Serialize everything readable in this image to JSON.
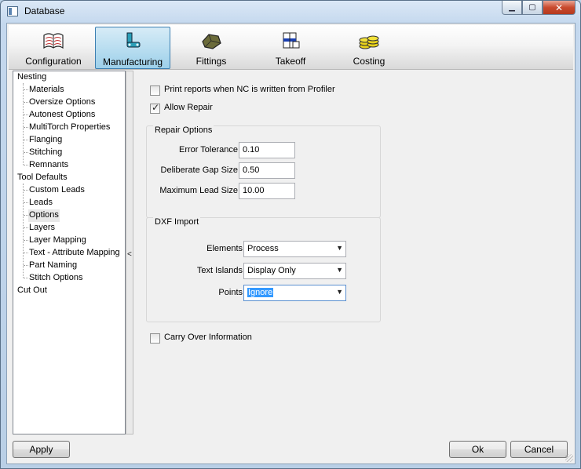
{
  "window": {
    "title": "Database"
  },
  "toolbar": {
    "tabs": [
      {
        "label": "Configuration",
        "icon": "book-icon"
      },
      {
        "label": "Manufacturing",
        "icon": "machine-icon",
        "selected": true
      },
      {
        "label": "Fittings",
        "icon": "fitting-icon"
      },
      {
        "label": "Takeoff",
        "icon": "takeoff-icon"
      },
      {
        "label": "Costing",
        "icon": "coins-icon"
      }
    ]
  },
  "tree": {
    "items": [
      {
        "label": "Nesting",
        "level": 0
      },
      {
        "label": "Materials",
        "level": 1
      },
      {
        "label": "Oversize Options",
        "level": 1
      },
      {
        "label": "Autonest Options",
        "level": 1
      },
      {
        "label": "MultiTorch Properties",
        "level": 1
      },
      {
        "label": "Flanging",
        "level": 1
      },
      {
        "label": "Stitching",
        "level": 1
      },
      {
        "label": "Remnants",
        "level": 1
      },
      {
        "label": "Tool Defaults",
        "level": 0
      },
      {
        "label": "Custom Leads",
        "level": 1
      },
      {
        "label": "Leads",
        "level": 1
      },
      {
        "label": "Options",
        "level": 1,
        "selected": true
      },
      {
        "label": "Layers",
        "level": 1
      },
      {
        "label": "Layer Mapping",
        "level": 1
      },
      {
        "label": "Text - Attribute Mapping",
        "level": 1
      },
      {
        "label": "Part Naming",
        "level": 1
      },
      {
        "label": "Stitch Options",
        "level": 1
      },
      {
        "label": "Cut Out",
        "level": 0
      }
    ]
  },
  "splitter": {
    "arrow": "<"
  },
  "options": {
    "print_reports": {
      "label": "Print reports when NC is written from Profiler",
      "checked": false
    },
    "allow_repair": {
      "label": "Allow Repair",
      "checked": true
    },
    "repair": {
      "title": "Repair Options",
      "error_tolerance": {
        "label": "Error Tolerance",
        "value": "0.10"
      },
      "gap_size": {
        "label": "Deliberate Gap Size",
        "value": "0.50"
      },
      "max_lead": {
        "label": "Maximum Lead Size",
        "value": "10.00"
      }
    },
    "dxf": {
      "title": "DXF Import",
      "elements": {
        "label": "Elements",
        "value": "Process"
      },
      "text_islands": {
        "label": "Text Islands",
        "value": "Display Only"
      },
      "points": {
        "label": "Points",
        "value": "Ignore"
      }
    },
    "carry_over": {
      "label": "Carry Over Information",
      "checked": false
    }
  },
  "buttons": {
    "apply": "Apply",
    "ok": "Ok",
    "cancel": "Cancel"
  }
}
